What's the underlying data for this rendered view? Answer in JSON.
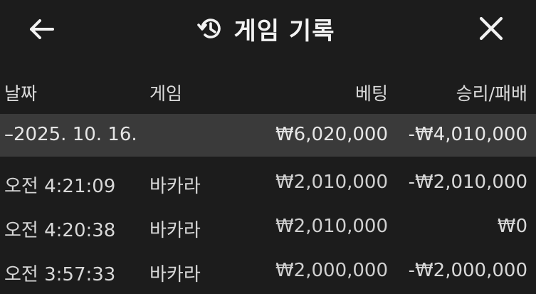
{
  "header": {
    "title": "게임 기록",
    "back_icon": "arrow-left-icon",
    "history_icon": "history-icon",
    "close_icon": "close-icon"
  },
  "columns": {
    "date": "날짜",
    "game": "게임",
    "bet": "베팅",
    "result": "승리/패배"
  },
  "summary": {
    "date": "–2025. 10. 16.",
    "bet": "₩6,020,000",
    "result": "-₩4,010,000"
  },
  "rows": [
    {
      "time": "오전 4:21:09",
      "game": "바카라",
      "bet": "₩2,010,000",
      "result": "-₩2,010,000"
    },
    {
      "time": "오전 4:20:38",
      "game": "바카라",
      "bet": "₩2,010,000",
      "result": "₩0"
    },
    {
      "time": "오전 3:57:33",
      "game": "바카라",
      "bet": "₩2,000,000",
      "result": "-₩2,000,000"
    }
  ]
}
